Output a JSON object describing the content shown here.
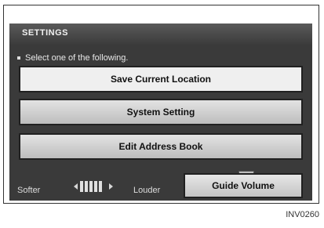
{
  "header": {
    "title": "SETTINGS"
  },
  "prompt": "Select one of the following.",
  "menu": [
    {
      "label": "Save Current Location"
    },
    {
      "label": "System Setting"
    },
    {
      "label": "Edit Address Book"
    }
  ],
  "volume": {
    "softer_label": "Softer",
    "louder_label": "Louder",
    "guide_label": "Guide Volume",
    "icon": "volume-bar-icon"
  },
  "figure_code": "INV0260"
}
